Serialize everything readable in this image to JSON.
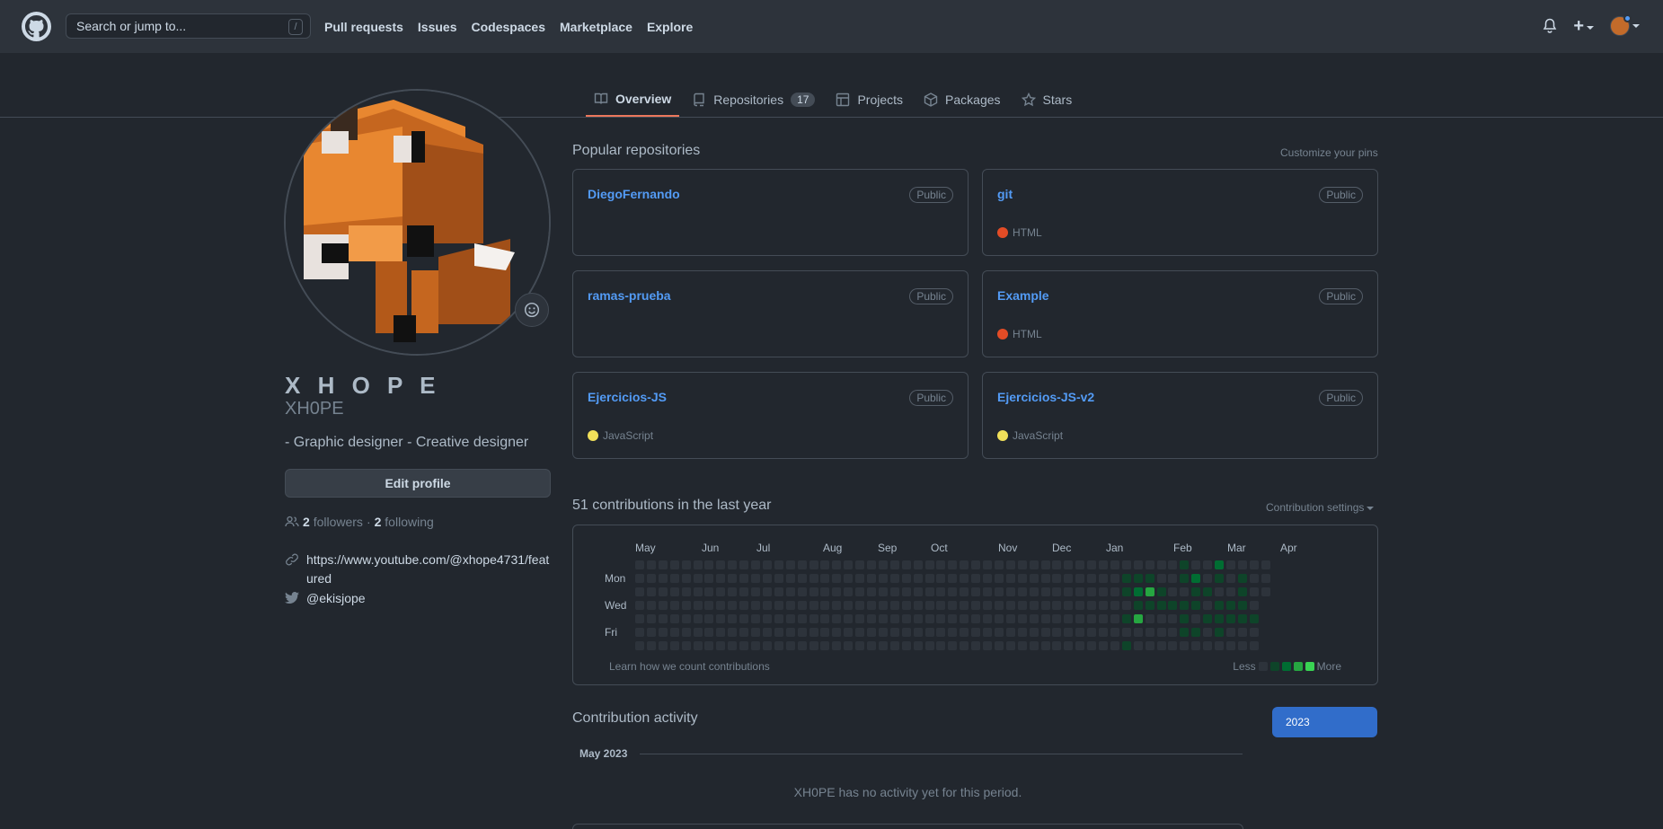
{
  "header": {
    "search_placeholder": "Search or jump to...",
    "search_shortcut": "/",
    "nav": [
      "Pull requests",
      "Issues",
      "Codespaces",
      "Marketplace",
      "Explore"
    ],
    "plus_label": "+"
  },
  "tabs": [
    {
      "label": "Overview",
      "icon": "book-icon",
      "active": true
    },
    {
      "label": "Repositories",
      "icon": "repo-icon",
      "count": "17"
    },
    {
      "label": "Projects",
      "icon": "table-icon"
    },
    {
      "label": "Packages",
      "icon": "package-icon"
    },
    {
      "label": "Stars",
      "icon": "star-icon"
    }
  ],
  "profile": {
    "fullname": "X H O P E",
    "username": "XH0PE",
    "bio": "- Graphic designer - Creative designer",
    "edit_label": "Edit profile",
    "followers_count": "2",
    "followers_label": "followers",
    "sep": "·",
    "following_count": "2",
    "following_label": "following",
    "website": "https://www.youtube.com/@xhope4731/featured",
    "twitter": "@ekisjope"
  },
  "popular": {
    "title": "Popular repositories",
    "customize": "Customize your pins",
    "repos": [
      {
        "name": "DiegoFernando",
        "badge": "Public",
        "lang": "",
        "lang_color": ""
      },
      {
        "name": "git",
        "badge": "Public",
        "lang": "HTML",
        "lang_color": "#e34c26"
      },
      {
        "name": "ramas-prueba",
        "badge": "Public",
        "lang": "",
        "lang_color": ""
      },
      {
        "name": "Example",
        "badge": "Public",
        "lang": "HTML",
        "lang_color": "#e34c26"
      },
      {
        "name": "Ejercicios-JS",
        "badge": "Public",
        "lang": "JavaScript",
        "lang_color": "#f1e05a"
      },
      {
        "name": "Ejercicios-JS-v2",
        "badge": "Public",
        "lang": "JavaScript",
        "lang_color": "#f1e05a"
      }
    ]
  },
  "contributions": {
    "title": "51 contributions in the last year",
    "settings": "Contribution settings",
    "months": [
      "May",
      "Jun",
      "Jul",
      "Aug",
      "Sep",
      "Oct",
      "Nov",
      "Dec",
      "Jan",
      "Feb",
      "Mar",
      "Apr"
    ],
    "days": [
      "Mon",
      "Wed",
      "Fri"
    ],
    "learn": "Learn how we count contributions",
    "less": "Less",
    "more": "More",
    "colors": [
      "#2d333b",
      "#0e4429",
      "#006d32",
      "#26a641",
      "#39d353"
    ],
    "active_cells": [
      [
        42,
        1,
        1
      ],
      [
        42,
        2,
        1
      ],
      [
        42,
        4,
        1
      ],
      [
        42,
        6,
        1
      ],
      [
        43,
        1,
        1
      ],
      [
        43,
        2,
        2
      ],
      [
        43,
        3,
        1
      ],
      [
        43,
        4,
        3
      ],
      [
        44,
        1,
        1
      ],
      [
        44,
        2,
        3
      ],
      [
        44,
        3,
        1
      ],
      [
        45,
        2,
        1
      ],
      [
        45,
        3,
        1
      ],
      [
        46,
        3,
        1
      ],
      [
        47,
        0,
        1
      ],
      [
        47,
        1,
        1
      ],
      [
        47,
        3,
        1
      ],
      [
        47,
        4,
        1
      ],
      [
        47,
        5,
        1
      ],
      [
        48,
        1,
        2
      ],
      [
        48,
        2,
        1
      ],
      [
        48,
        3,
        1
      ],
      [
        48,
        5,
        1
      ],
      [
        49,
        2,
        1
      ],
      [
        49,
        4,
        1
      ],
      [
        50,
        0,
        2
      ],
      [
        50,
        1,
        1
      ],
      [
        50,
        3,
        1
      ],
      [
        50,
        4,
        1
      ],
      [
        50,
        5,
        1
      ],
      [
        51,
        3,
        1
      ],
      [
        51,
        4,
        1
      ],
      [
        52,
        1,
        1
      ],
      [
        52,
        2,
        1
      ],
      [
        52,
        3,
        1
      ],
      [
        52,
        4,
        1
      ],
      [
        53,
        4,
        1
      ],
      [
        54,
        4,
        1
      ]
    ]
  },
  "activity": {
    "title": "Contribution activity",
    "year": "2023",
    "month": "May 2023",
    "empty": "XH0PE has no activity yet for this period."
  }
}
